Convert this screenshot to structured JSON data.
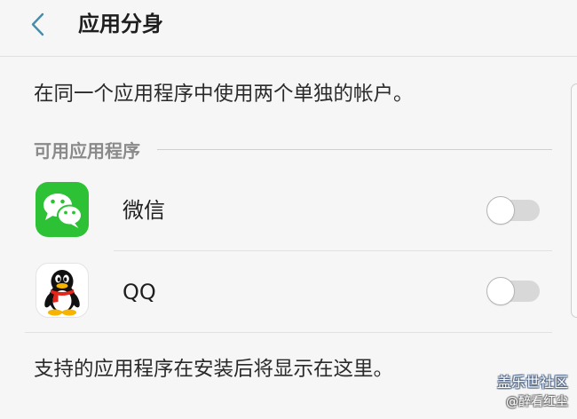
{
  "header": {
    "title": "应用分身",
    "back_icon": "chevron-left-icon"
  },
  "description": "在同一个应用程序中使用两个单独的帐户。",
  "section": {
    "title": "可用应用程序"
  },
  "apps": [
    {
      "name": "微信",
      "icon": "wechat-icon",
      "enabled": false
    },
    {
      "name": "QQ",
      "icon": "qq-penguin-icon",
      "enabled": false
    }
  ],
  "footer_note": "支持的应用程序在安装后将显示在这里。",
  "watermark": {
    "line1": "盖乐世社区",
    "line2": "@醉看红尘"
  },
  "colors": {
    "accent": "#4a8ba8",
    "background": "#f6f6f6",
    "text": "#1e1e1e",
    "muted": "#8a8a8a",
    "divider": "#e1e1e1",
    "toggle_off_track": "#d8d8d8",
    "wechat_green": "#2dc135"
  }
}
